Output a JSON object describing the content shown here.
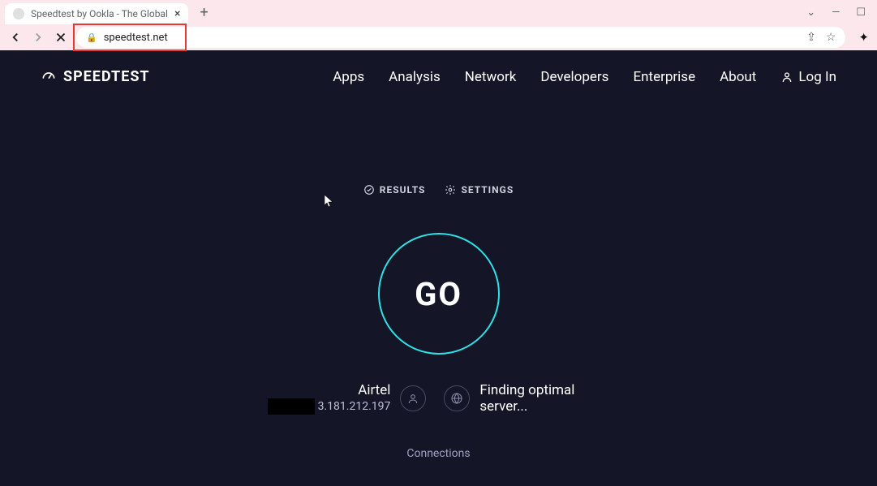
{
  "browser": {
    "tab_title": "Speedtest by Ookla - The Global",
    "url": "speedtest.net"
  },
  "header": {
    "logo": "SPEEDTEST",
    "nav": {
      "apps": "Apps",
      "analysis": "Analysis",
      "network": "Network",
      "developers": "Developers",
      "enterprise": "Enterprise",
      "about": "About"
    },
    "login": "Log In"
  },
  "tabs": {
    "results": "RESULTS",
    "settings": "SETTINGS"
  },
  "go_button": "GO",
  "client": {
    "isp": "Airtel",
    "ip_visible": "3.181.212.197"
  },
  "server": {
    "status": "Finding optimal server..."
  },
  "connections_label": "Connections"
}
